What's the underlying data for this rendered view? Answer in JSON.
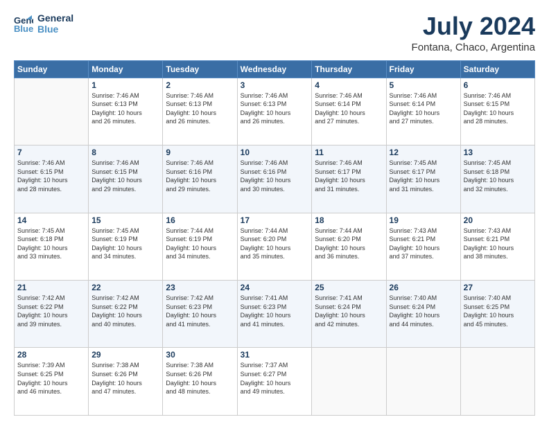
{
  "logo": {
    "line1": "General",
    "line2": "Blue"
  },
  "title": "July 2024",
  "subtitle": "Fontana, Chaco, Argentina",
  "weekdays": [
    "Sunday",
    "Monday",
    "Tuesday",
    "Wednesday",
    "Thursday",
    "Friday",
    "Saturday"
  ],
  "weeks": [
    [
      {
        "day": "",
        "info": ""
      },
      {
        "day": "1",
        "info": "Sunrise: 7:46 AM\nSunset: 6:13 PM\nDaylight: 10 hours\nand 26 minutes."
      },
      {
        "day": "2",
        "info": "Sunrise: 7:46 AM\nSunset: 6:13 PM\nDaylight: 10 hours\nand 26 minutes."
      },
      {
        "day": "3",
        "info": "Sunrise: 7:46 AM\nSunset: 6:13 PM\nDaylight: 10 hours\nand 26 minutes."
      },
      {
        "day": "4",
        "info": "Sunrise: 7:46 AM\nSunset: 6:14 PM\nDaylight: 10 hours\nand 27 minutes."
      },
      {
        "day": "5",
        "info": "Sunrise: 7:46 AM\nSunset: 6:14 PM\nDaylight: 10 hours\nand 27 minutes."
      },
      {
        "day": "6",
        "info": "Sunrise: 7:46 AM\nSunset: 6:15 PM\nDaylight: 10 hours\nand 28 minutes."
      }
    ],
    [
      {
        "day": "7",
        "info": "Sunrise: 7:46 AM\nSunset: 6:15 PM\nDaylight: 10 hours\nand 28 minutes."
      },
      {
        "day": "8",
        "info": "Sunrise: 7:46 AM\nSunset: 6:15 PM\nDaylight: 10 hours\nand 29 minutes."
      },
      {
        "day": "9",
        "info": "Sunrise: 7:46 AM\nSunset: 6:16 PM\nDaylight: 10 hours\nand 29 minutes."
      },
      {
        "day": "10",
        "info": "Sunrise: 7:46 AM\nSunset: 6:16 PM\nDaylight: 10 hours\nand 30 minutes."
      },
      {
        "day": "11",
        "info": "Sunrise: 7:46 AM\nSunset: 6:17 PM\nDaylight: 10 hours\nand 31 minutes."
      },
      {
        "day": "12",
        "info": "Sunrise: 7:45 AM\nSunset: 6:17 PM\nDaylight: 10 hours\nand 31 minutes."
      },
      {
        "day": "13",
        "info": "Sunrise: 7:45 AM\nSunset: 6:18 PM\nDaylight: 10 hours\nand 32 minutes."
      }
    ],
    [
      {
        "day": "14",
        "info": "Sunrise: 7:45 AM\nSunset: 6:18 PM\nDaylight: 10 hours\nand 33 minutes."
      },
      {
        "day": "15",
        "info": "Sunrise: 7:45 AM\nSunset: 6:19 PM\nDaylight: 10 hours\nand 34 minutes."
      },
      {
        "day": "16",
        "info": "Sunrise: 7:44 AM\nSunset: 6:19 PM\nDaylight: 10 hours\nand 34 minutes."
      },
      {
        "day": "17",
        "info": "Sunrise: 7:44 AM\nSunset: 6:20 PM\nDaylight: 10 hours\nand 35 minutes."
      },
      {
        "day": "18",
        "info": "Sunrise: 7:44 AM\nSunset: 6:20 PM\nDaylight: 10 hours\nand 36 minutes."
      },
      {
        "day": "19",
        "info": "Sunrise: 7:43 AM\nSunset: 6:21 PM\nDaylight: 10 hours\nand 37 minutes."
      },
      {
        "day": "20",
        "info": "Sunrise: 7:43 AM\nSunset: 6:21 PM\nDaylight: 10 hours\nand 38 minutes."
      }
    ],
    [
      {
        "day": "21",
        "info": "Sunrise: 7:42 AM\nSunset: 6:22 PM\nDaylight: 10 hours\nand 39 minutes."
      },
      {
        "day": "22",
        "info": "Sunrise: 7:42 AM\nSunset: 6:22 PM\nDaylight: 10 hours\nand 40 minutes."
      },
      {
        "day": "23",
        "info": "Sunrise: 7:42 AM\nSunset: 6:23 PM\nDaylight: 10 hours\nand 41 minutes."
      },
      {
        "day": "24",
        "info": "Sunrise: 7:41 AM\nSunset: 6:23 PM\nDaylight: 10 hours\nand 41 minutes."
      },
      {
        "day": "25",
        "info": "Sunrise: 7:41 AM\nSunset: 6:24 PM\nDaylight: 10 hours\nand 42 minutes."
      },
      {
        "day": "26",
        "info": "Sunrise: 7:40 AM\nSunset: 6:24 PM\nDaylight: 10 hours\nand 44 minutes."
      },
      {
        "day": "27",
        "info": "Sunrise: 7:40 AM\nSunset: 6:25 PM\nDaylight: 10 hours\nand 45 minutes."
      }
    ],
    [
      {
        "day": "28",
        "info": "Sunrise: 7:39 AM\nSunset: 6:25 PM\nDaylight: 10 hours\nand 46 minutes."
      },
      {
        "day": "29",
        "info": "Sunrise: 7:38 AM\nSunset: 6:26 PM\nDaylight: 10 hours\nand 47 minutes."
      },
      {
        "day": "30",
        "info": "Sunrise: 7:38 AM\nSunset: 6:26 PM\nDaylight: 10 hours\nand 48 minutes."
      },
      {
        "day": "31",
        "info": "Sunrise: 7:37 AM\nSunset: 6:27 PM\nDaylight: 10 hours\nand 49 minutes."
      },
      {
        "day": "",
        "info": ""
      },
      {
        "day": "",
        "info": ""
      },
      {
        "day": "",
        "info": ""
      }
    ]
  ]
}
